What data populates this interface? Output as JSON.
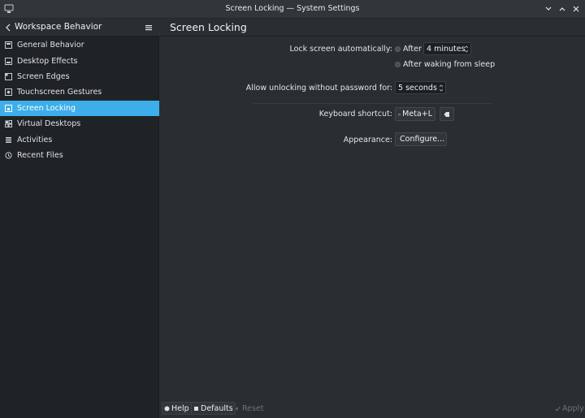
{
  "window": {
    "title": "Screen Locking — System Settings",
    "icon": "system-settings-icon",
    "controls": [
      "minimize-icon",
      "maximize-icon",
      "close-icon"
    ]
  },
  "sidebar": {
    "heading": "Workspace Behavior",
    "items": [
      {
        "label": "General Behavior",
        "icon": "general-behavior-icon"
      },
      {
        "label": "Desktop Effects",
        "icon": "desktop-effects-icon"
      },
      {
        "label": "Screen Edges",
        "icon": "screen-edges-icon"
      },
      {
        "label": "Touchscreen Gestures",
        "icon": "touchscreen-icon"
      },
      {
        "label": "Screen Locking",
        "icon": "screen-locking-icon",
        "active": true
      },
      {
        "label": "Virtual Desktops",
        "icon": "virtual-desktops-icon"
      },
      {
        "label": "Activities",
        "icon": "activities-icon"
      },
      {
        "label": "Recent Files",
        "icon": "recent-files-icon"
      }
    ]
  },
  "page": {
    "title": "Screen Locking",
    "lock_auto": {
      "label": "Lock screen automatically:",
      "after_label": "After",
      "minutes_value": "4 minutes",
      "sleep_label": "After waking from sleep"
    },
    "unlock": {
      "label": "Allow unlocking without password for:",
      "value": "5 seconds"
    },
    "shortcut": {
      "label": "Keyboard shortcut:",
      "value": "Meta+L"
    },
    "appearance": {
      "label": "Appearance:",
      "button": "Configure..."
    }
  },
  "footer": {
    "help": "Help",
    "defaults": "Defaults",
    "reset": "Reset",
    "apply": "Apply"
  },
  "colors": {
    "accent": "#3daee9",
    "background": "#2a2e32",
    "sidebar": "#202326"
  }
}
